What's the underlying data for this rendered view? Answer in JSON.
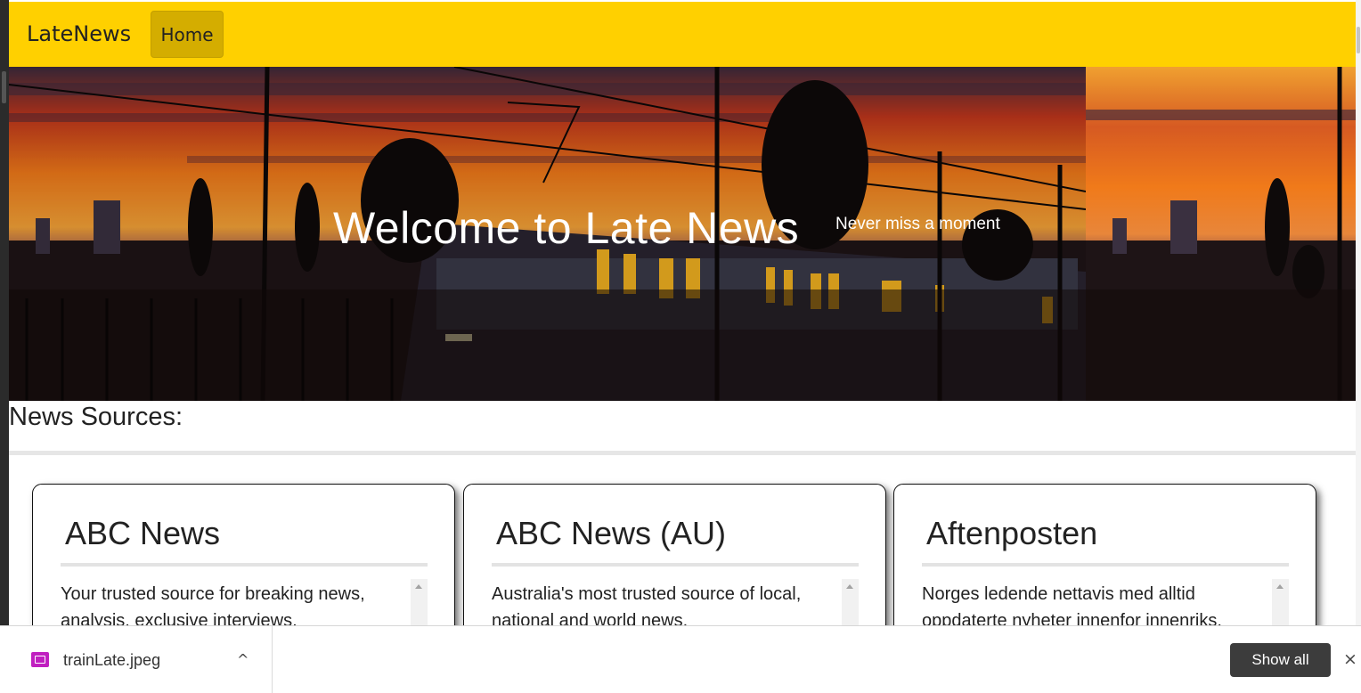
{
  "navbar": {
    "brand": "LateNews",
    "home_label": "Home",
    "bg_color": "#ffd000"
  },
  "hero": {
    "title": "Welcome to Late News",
    "subtitle": "Never miss a moment",
    "image_name": "train-at-sunset"
  },
  "sources": {
    "heading": "News Sources:",
    "cards": [
      {
        "name": "ABC News",
        "description": "Your trusted source for breaking news, analysis, exclusive interviews,"
      },
      {
        "name": "ABC News (AU)",
        "description": "Australia's most trusted source of local, national and world news."
      },
      {
        "name": "Aftenposten",
        "description": "Norges ledende nettavis med alltid oppdaterte nyheter innenfor innenriks,"
      }
    ]
  },
  "download_bar": {
    "file_name": "trainLate.jpeg",
    "show_all_label": "Show all",
    "chevron": "^",
    "close": "×"
  }
}
